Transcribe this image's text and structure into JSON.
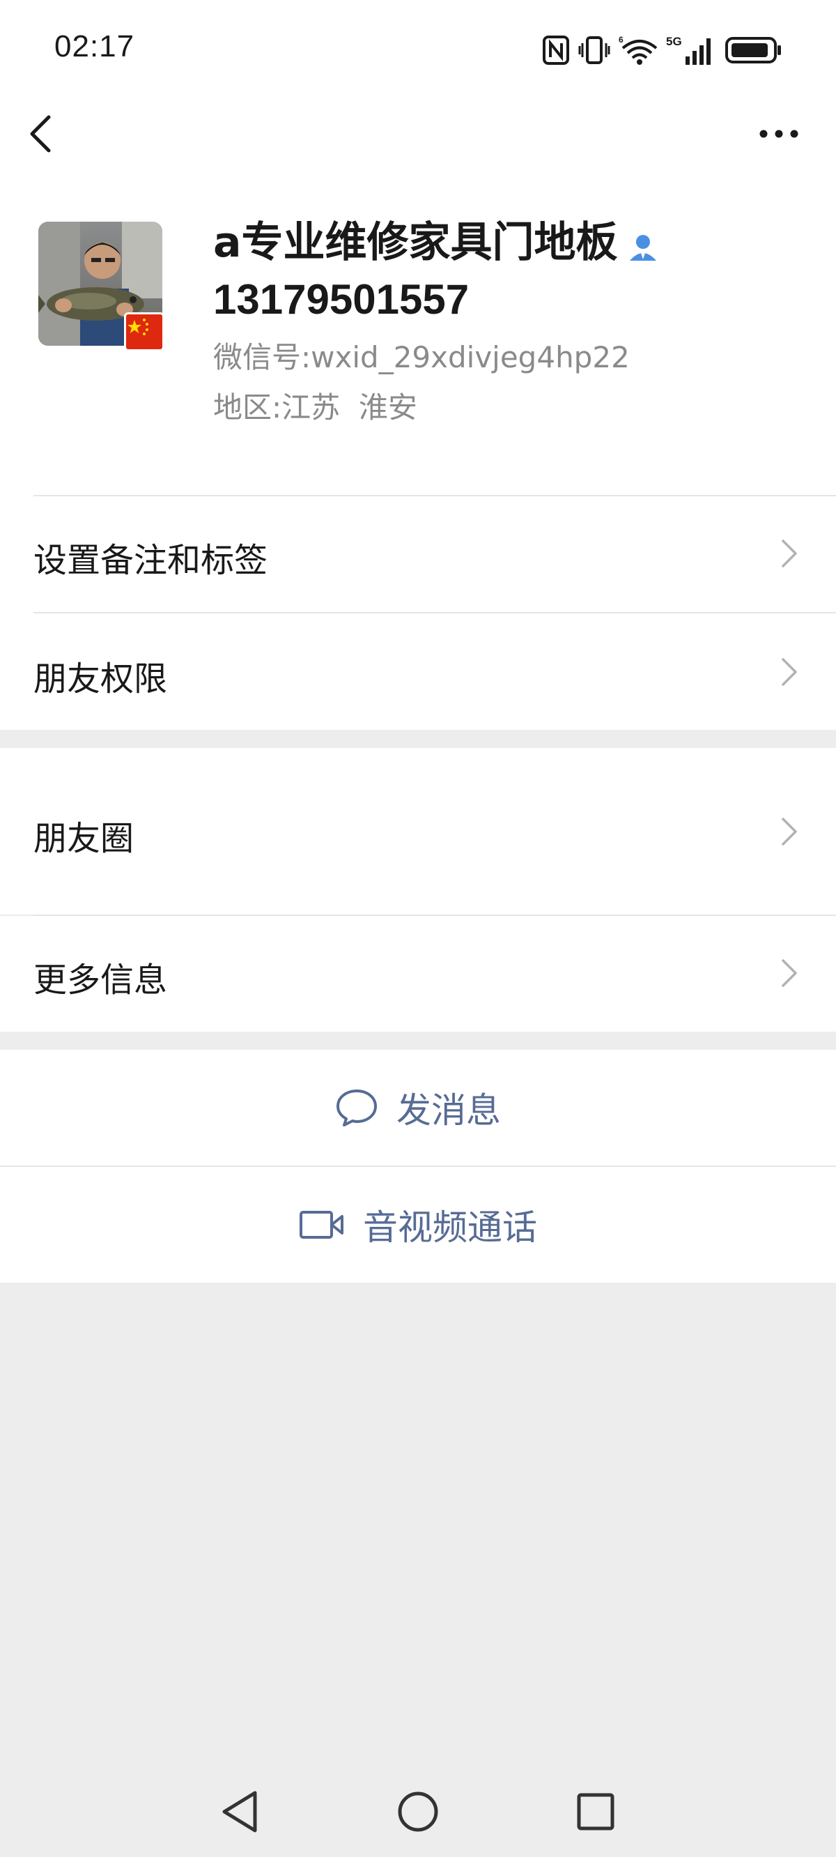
{
  "status_bar": {
    "time": "02:17",
    "icons": [
      "nfc-icon",
      "vibrate-icon",
      "wifi-6-icon",
      "signal-5g-icon",
      "battery-icon"
    ]
  },
  "nav": {
    "back_icon": "chevron-left-icon",
    "more_icon": "more-dots-icon"
  },
  "profile": {
    "name": "a专业维修家具门地板",
    "phone": "13179501557",
    "wechat_id_label": "微信号:",
    "wechat_id": "wxid_29xdivjeg4hp22",
    "region_label": "地区:",
    "region": "江苏  淮安",
    "badge_icon": "contact-person-icon",
    "flag_icon": "china-flag-icon"
  },
  "menu": {
    "group1": [
      {
        "label": "设置备注和标签"
      },
      {
        "label": "朋友权限"
      }
    ],
    "group2": [
      {
        "label": "朋友圈"
      },
      {
        "label": "更多信息"
      }
    ]
  },
  "actions": {
    "message": "发消息",
    "call": "音视频通话"
  },
  "colors": {
    "link_blue": "#576b95",
    "background": "#ededed",
    "card": "#ffffff"
  }
}
